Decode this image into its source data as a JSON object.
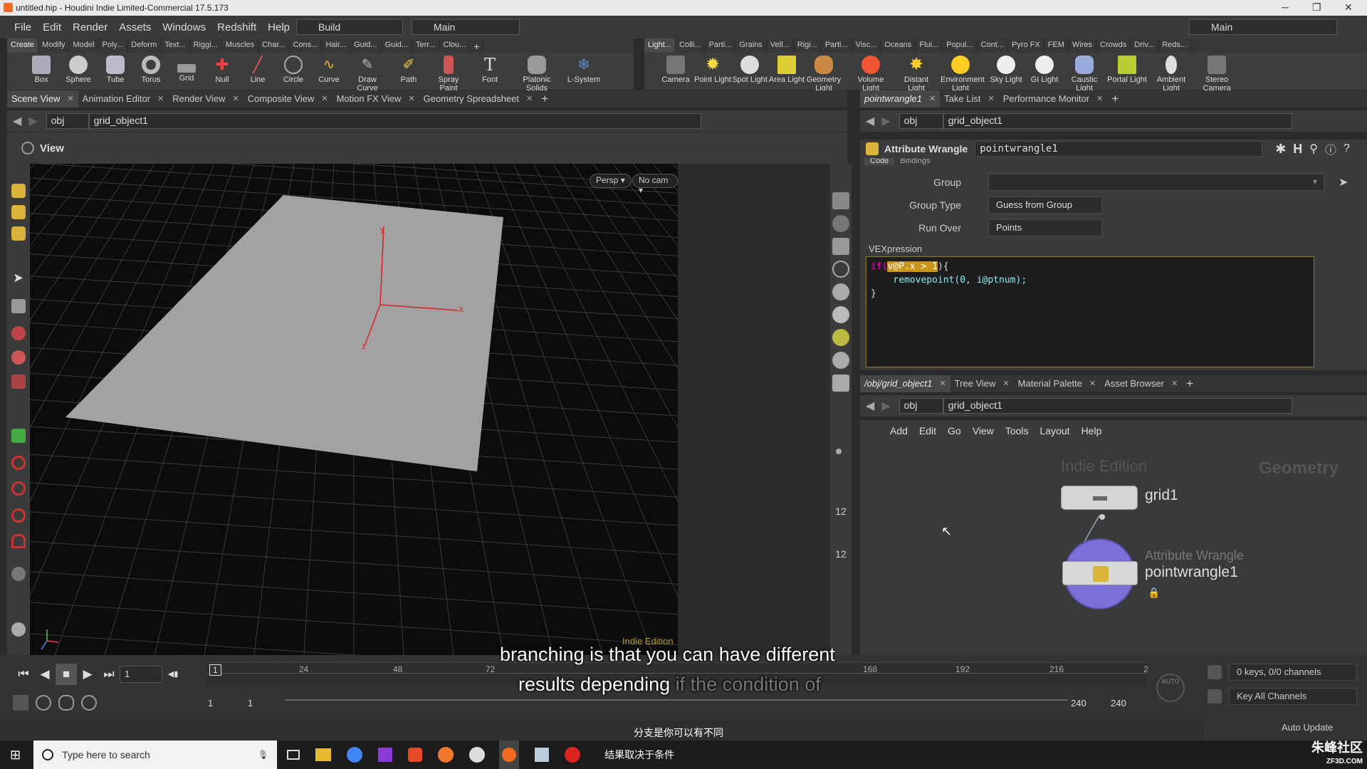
{
  "window": {
    "title": "untitled.hip - Houdini Indie Limited-Commercial 17.5.173"
  },
  "menu": {
    "items": [
      "File",
      "Edit",
      "Render",
      "Assets",
      "Windows",
      "Redshift",
      "Help"
    ],
    "desktop_build": "Build",
    "desktop_main": "Main",
    "desktop_right": "Main"
  },
  "shelf_left": {
    "tabs": [
      "Create",
      "Modify",
      "Model",
      "Poly...",
      "Deform",
      "Text...",
      "Riggi...",
      "Muscles",
      "Char...",
      "Cons...",
      "Hair...",
      "Guid...",
      "Guid...",
      "Terr...",
      "Clou..."
    ],
    "tools": [
      "Box",
      "Sphere",
      "Tube",
      "Torus",
      "Grid",
      "Null",
      "Line",
      "Circle",
      "Curve",
      "Draw Curve",
      "Path",
      "Spray Paint",
      "Font",
      "Platonic Solids",
      "L-System"
    ]
  },
  "shelf_right": {
    "tabs": [
      "Light...",
      "Colli...",
      "Parti...",
      "Grains",
      "Vell...",
      "Rigi...",
      "Parti...",
      "Visc...",
      "Oceans",
      "Flui...",
      "Popul...",
      "Cont...",
      "Pyro FX",
      "FEM",
      "Wires",
      "Crowds",
      "Driv...",
      "Reds..."
    ],
    "tools": [
      "Camera",
      "Point Light",
      "Spot Light",
      "Area Light",
      "Geometry Light",
      "Volume Light",
      "Distant Light",
      "Environment Light",
      "Sky Light",
      "GI Light",
      "Caustic Light",
      "Portal Light",
      "Ambient Light",
      "Stereo Camera"
    ]
  },
  "left_pane": {
    "tabs": [
      "Scene View",
      "Animation Editor",
      "Render View",
      "Composite View",
      "Motion FX View",
      "Geometry Spreadsheet"
    ],
    "path": {
      "root": "obj",
      "node": "grid_object1"
    },
    "view_label": "View",
    "persp": "Persp",
    "cam": "No cam",
    "watermark": "Indie Edition",
    "axis_x": "x",
    "axis_y": "y",
    "axis_z": "z"
  },
  "param_pane": {
    "tabs": [
      "pointwrangle1",
      "Take List",
      "Performance Monitor"
    ],
    "path": {
      "root": "obj",
      "node": "grid_object1"
    },
    "node_type": "Attribute Wrangle",
    "node_name": "pointwrangle1",
    "subtabs": [
      "Code",
      "Bindings"
    ],
    "group_label": "Group",
    "group_value": "",
    "group_type_label": "Group Type",
    "group_type_value": "Guess from Group",
    "run_over_label": "Run Over",
    "run_over_value": "Points",
    "vex_label": "VEXpression",
    "code": {
      "line1_kw": "if(",
      "line1_hl": "v@P.x > 1",
      "line1_end": "){",
      "line2": "    removepoint(0, i@ptnum);",
      "line3": "}"
    }
  },
  "network_pane": {
    "tabs": [
      "/obj/grid_object1",
      "Tree View",
      "Material Palette",
      "Asset Browser"
    ],
    "path": {
      "root": "obj",
      "node": "grid_object1"
    },
    "menu": [
      "Add",
      "Edit",
      "Go",
      "View",
      "Tools",
      "Layout",
      "Help"
    ],
    "watermark": "Indie Edition",
    "context": "Geometry",
    "nodes": [
      {
        "name": "grid1",
        "type": ""
      },
      {
        "name": "pointwrangle1",
        "type": "Attribute Wrangle"
      }
    ]
  },
  "timeline": {
    "current_frame": "1",
    "ticks": [
      "1",
      "24",
      "48",
      "72",
      "168",
      "192",
      "216",
      "2"
    ],
    "range_start": "1",
    "range_start2": "1",
    "range_end": "240",
    "range_end2": "240",
    "keys_status": "0 keys, 0/0 channels",
    "key_all": "Key All Channels",
    "auto_update": "Auto Update",
    "auto": "AUTO"
  },
  "captions": {
    "line1": "branching is that you can have different",
    "line2_bright": "results depending",
    "line2_dim": "if the condition of",
    "cn1": "分支是你可以有不同",
    "cn2": "结果取决于条件"
  },
  "taskbar": {
    "search_placeholder": "Type here to search",
    "brand": "朱峰社区",
    "brand_sub": "ZF3D.COM"
  },
  "colors": {
    "accent_orange": "#f26b21",
    "highlight": "#c8941c",
    "wrangle_node": "#7b6fd8",
    "axis_red": "#e02020"
  }
}
